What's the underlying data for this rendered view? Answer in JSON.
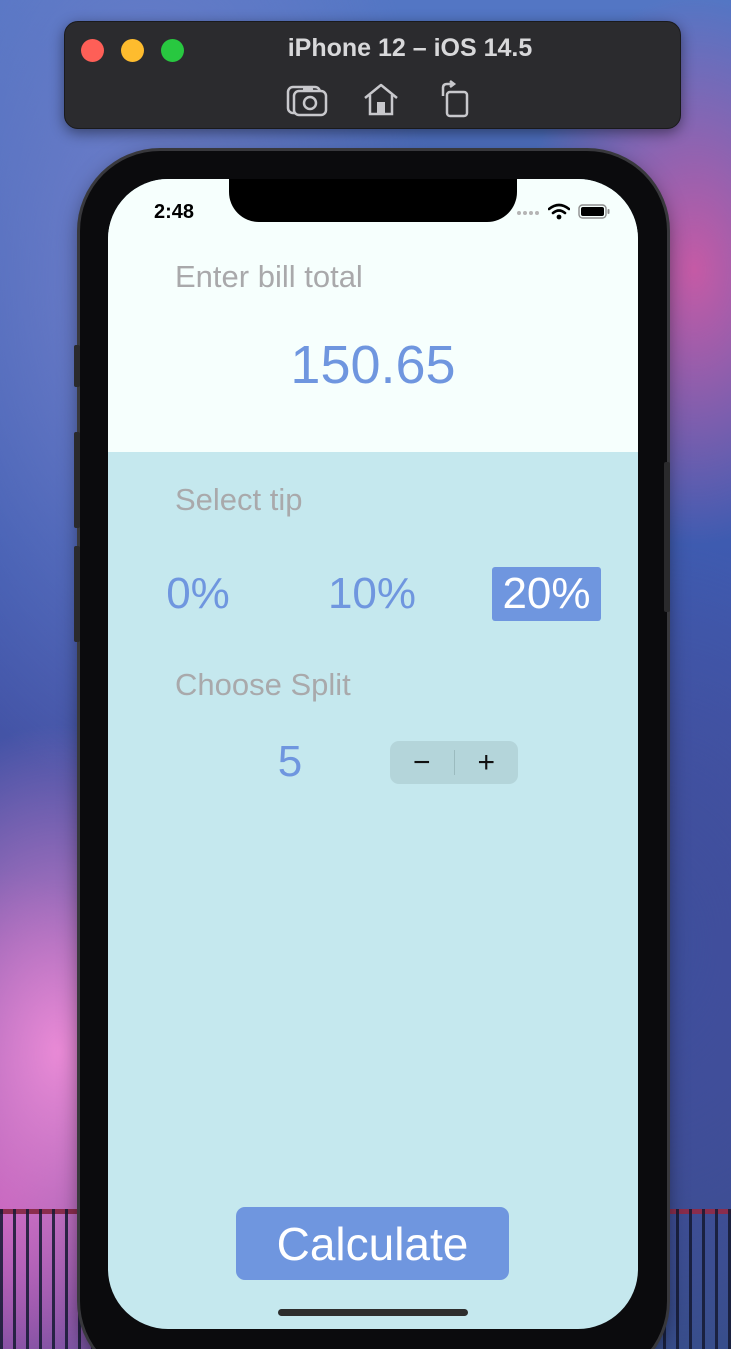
{
  "simulator": {
    "title": "iPhone 12 – iOS 14.5",
    "tools": [
      "screenshot-icon",
      "home-icon",
      "rotate-icon"
    ]
  },
  "status_bar": {
    "time": "2:48"
  },
  "bill": {
    "label": "Enter bill total",
    "value": "150.65"
  },
  "tip": {
    "label": "Select tip",
    "options": [
      "0%",
      "10%",
      "20%"
    ],
    "selected": "20%"
  },
  "split": {
    "label": "Choose Split",
    "value": "5",
    "decrement": "−",
    "increment": "+"
  },
  "calculate_label": "Calculate",
  "colors": {
    "accent": "#6f96df",
    "top_panel": "#f6fffd",
    "bottom_panel": "#c5e8ee",
    "label_gray": "#a9a9ab"
  }
}
